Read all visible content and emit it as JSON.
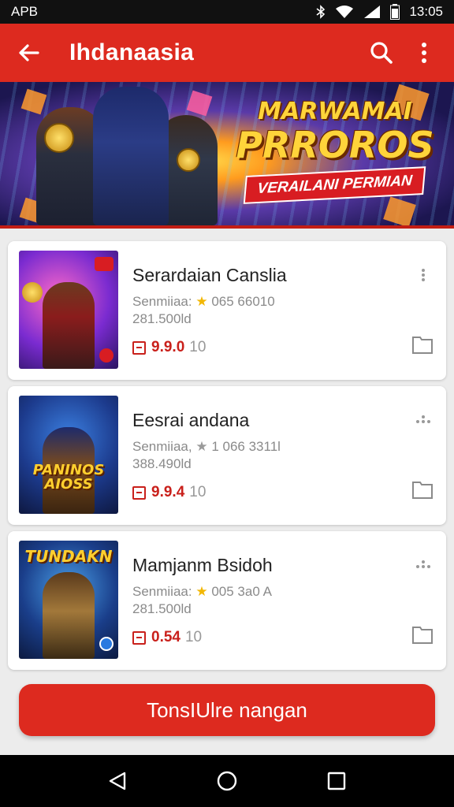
{
  "status_bar": {
    "carrier": "APB",
    "time": "13:05"
  },
  "app_bar": {
    "title": "Ihdanaasia"
  },
  "banner": {
    "headline_top": "MARWAMAI",
    "headline_main": "PRROROS",
    "ribbon": "VERAILANI PERMIAN"
  },
  "games": [
    {
      "name": "Serardaian Canslia",
      "meta_prefix": "Senmiiaa:",
      "meta_suffix": "065 66010",
      "meta_line2": "281.500ld",
      "price": "9.9.0",
      "price_sub": "10",
      "thumb_label": ""
    },
    {
      "name": "Eesrai andana",
      "meta_prefix": "Senmiiaa,",
      "meta_suffix": "1 066 3311l",
      "meta_line2": "388.490ld",
      "price": "9.9.4",
      "price_sub": "10",
      "thumb_label": "PANINOS AIOSS"
    },
    {
      "name": "Mamjanm Bsidoh",
      "meta_prefix": "Senmiiaa:",
      "meta_suffix": "005 3a0 A",
      "meta_line2": "281.500ld",
      "price": "0.54",
      "price_sub": "10",
      "thumb_label": "TUNDAKN"
    }
  ],
  "cta": {
    "label": "TonsIUlre nangan"
  },
  "colors": {
    "brand_red": "#dd2a1f",
    "price_red": "#c9201b",
    "star": "#f2b705"
  }
}
